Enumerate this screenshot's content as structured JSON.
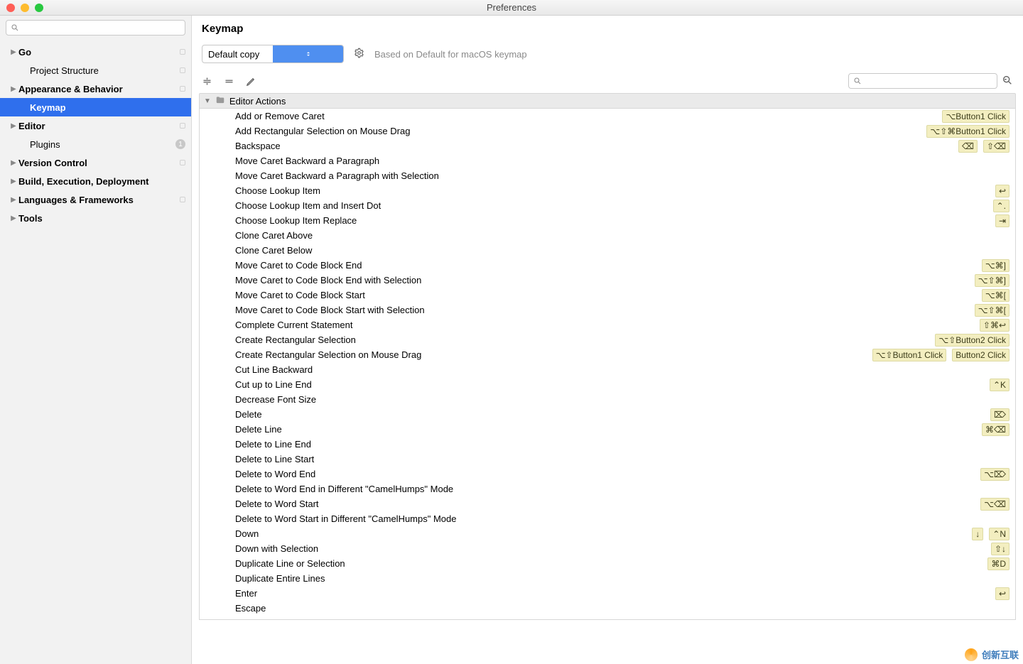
{
  "window": {
    "title": "Preferences"
  },
  "sidebar": {
    "search_placeholder": "",
    "items": [
      {
        "label": "Go",
        "arrow": true,
        "bold": true,
        "proj": true
      },
      {
        "label": "Project Structure",
        "arrow": false,
        "indent": true,
        "proj": true
      },
      {
        "label": "Appearance & Behavior",
        "arrow": true,
        "bold": true,
        "proj": true
      },
      {
        "label": "Keymap",
        "arrow": false,
        "indent": true,
        "bold": true,
        "selected": true
      },
      {
        "label": "Editor",
        "arrow": true,
        "bold": true,
        "proj": true
      },
      {
        "label": "Plugins",
        "arrow": false,
        "indent": true,
        "badge": "1"
      },
      {
        "label": "Version Control",
        "arrow": true,
        "bold": true,
        "proj": true
      },
      {
        "label": "Build, Execution, Deployment",
        "arrow": true,
        "bold": true
      },
      {
        "label": "Languages & Frameworks",
        "arrow": true,
        "bold": true,
        "proj": true
      },
      {
        "label": "Tools",
        "arrow": true,
        "bold": true
      }
    ]
  },
  "main": {
    "title": "Keymap",
    "keymap_selected": "Default copy",
    "based_on": "Based on Default for macOS keymap",
    "action_search_placeholder": "",
    "tree_section": "Editor Actions",
    "actions": [
      {
        "name": "Add or Remove Caret",
        "shortcuts": [
          "⌥Button1 Click"
        ]
      },
      {
        "name": "Add Rectangular Selection on Mouse Drag",
        "shortcuts": [
          "⌥⇧⌘Button1 Click"
        ]
      },
      {
        "name": "Backspace",
        "shortcuts": [
          "⌫",
          "⇧⌫"
        ]
      },
      {
        "name": "Move Caret Backward a Paragraph",
        "shortcuts": []
      },
      {
        "name": "Move Caret Backward a Paragraph with Selection",
        "shortcuts": []
      },
      {
        "name": "Choose Lookup Item",
        "shortcuts": [
          "↩"
        ]
      },
      {
        "name": "Choose Lookup Item and Insert Dot",
        "shortcuts": [
          "⌃."
        ]
      },
      {
        "name": "Choose Lookup Item Replace",
        "shortcuts": [
          "⇥"
        ]
      },
      {
        "name": "Clone Caret Above",
        "shortcuts": []
      },
      {
        "name": "Clone Caret Below",
        "shortcuts": []
      },
      {
        "name": "Move Caret to Code Block End",
        "shortcuts": [
          "⌥⌘]"
        ]
      },
      {
        "name": "Move Caret to Code Block End with Selection",
        "shortcuts": [
          "⌥⇧⌘]"
        ]
      },
      {
        "name": "Move Caret to Code Block Start",
        "shortcuts": [
          "⌥⌘["
        ]
      },
      {
        "name": "Move Caret to Code Block Start with Selection",
        "shortcuts": [
          "⌥⇧⌘["
        ]
      },
      {
        "name": "Complete Current Statement",
        "shortcuts": [
          "⇧⌘↩"
        ]
      },
      {
        "name": "Create Rectangular Selection",
        "shortcuts": [
          "⌥⇧Button2 Click"
        ]
      },
      {
        "name": "Create Rectangular Selection on Mouse Drag",
        "shortcuts": [
          "⌥⇧Button1 Click",
          "Button2 Click"
        ]
      },
      {
        "name": "Cut Line Backward",
        "shortcuts": []
      },
      {
        "name": "Cut up to Line End",
        "shortcuts": [
          "⌃K"
        ]
      },
      {
        "name": "Decrease Font Size",
        "shortcuts": []
      },
      {
        "name": "Delete",
        "shortcuts": [
          "⌦"
        ]
      },
      {
        "name": "Delete Line",
        "shortcuts": [
          "⌘⌫"
        ]
      },
      {
        "name": "Delete to Line End",
        "shortcuts": []
      },
      {
        "name": "Delete to Line Start",
        "shortcuts": []
      },
      {
        "name": "Delete to Word End",
        "shortcuts": [
          "⌥⌦"
        ]
      },
      {
        "name": "Delete to Word End in Different \"CamelHumps\" Mode",
        "shortcuts": []
      },
      {
        "name": "Delete to Word Start",
        "shortcuts": [
          "⌥⌫"
        ]
      },
      {
        "name": "Delete to Word Start in Different \"CamelHumps\" Mode",
        "shortcuts": []
      },
      {
        "name": "Down",
        "shortcuts": [
          "↓",
          "⌃N"
        ]
      },
      {
        "name": "Down with Selection",
        "shortcuts": [
          "⇧↓"
        ]
      },
      {
        "name": "Duplicate Line or Selection",
        "shortcuts": [
          "⌘D"
        ]
      },
      {
        "name": "Duplicate Entire Lines",
        "shortcuts": []
      },
      {
        "name": "Enter",
        "shortcuts": [
          "↩"
        ]
      },
      {
        "name": "Escape",
        "shortcuts": []
      }
    ]
  },
  "watermark": "创新互联"
}
